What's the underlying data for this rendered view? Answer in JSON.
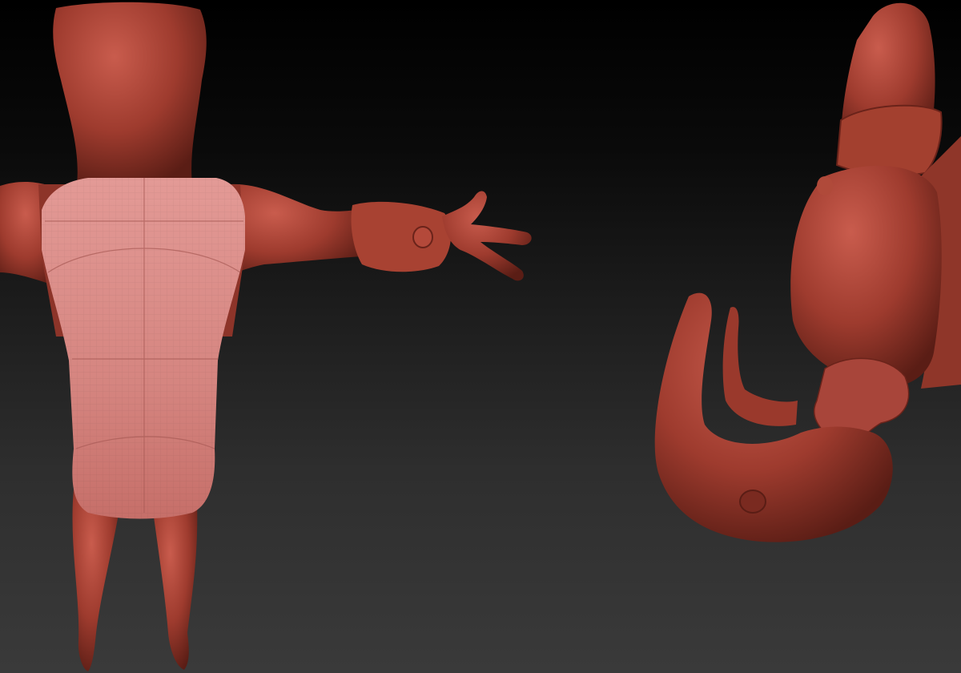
{
  "viewport": {
    "background_top": "#000000",
    "background_bottom": "#3a3a3a"
  },
  "materials": {
    "clay": "#9e3b2e",
    "clay_highlight": "#c0574a",
    "clay_shadow": "#5a1d15",
    "lowres_cloth": "#d88a86",
    "lowres_cloth_shade": "#b5625c"
  },
  "models": [
    {
      "name": "character-back-view",
      "kind": "sculpt-back-view"
    },
    {
      "name": "character-top-down-view",
      "kind": "sculpt-inverted-view"
    }
  ]
}
